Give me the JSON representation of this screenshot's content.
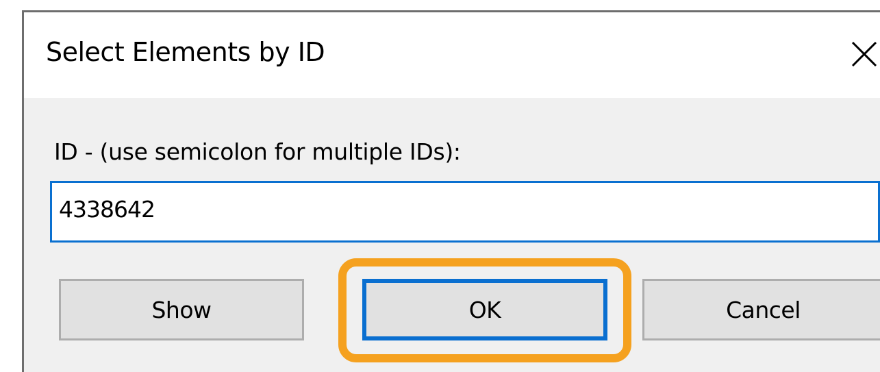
{
  "dialog": {
    "title": "Select Elements by ID",
    "close_icon": "close-icon",
    "prompt_label": "ID - (use semicolon for multiple IDs):",
    "id_input_value": "4338642",
    "buttons": {
      "show_label": "Show",
      "ok_label": "OK",
      "cancel_label": "Cancel"
    }
  },
  "colors": {
    "accent": "#0a70d0",
    "highlight": "#f5a11f",
    "dialog_background": "#f0f0f0",
    "button_background": "#e1e1e1"
  }
}
